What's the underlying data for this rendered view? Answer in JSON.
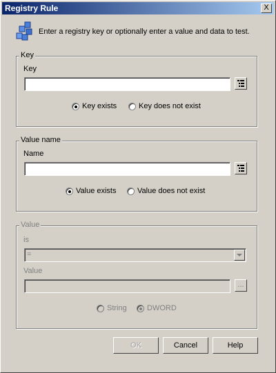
{
  "window": {
    "title": "Registry Rule",
    "close_label": "X"
  },
  "header": {
    "instruction": "Enter a registry key or optionally enter a value and data to test.",
    "icon": "registry-cubes-icon"
  },
  "key_group": {
    "legend": "Key",
    "field_label": "Key",
    "field_value": "",
    "radio_exists": "Key exists",
    "radio_not_exists": "Key does not exist",
    "selected": "exists"
  },
  "value_name_group": {
    "legend": "Value name",
    "field_label": "Name",
    "field_value": "",
    "radio_exists": "Value exists",
    "radio_not_exists": "Value does not exist",
    "selected": "exists"
  },
  "value_group": {
    "legend": "Value",
    "is_label": "is",
    "operator": "=",
    "value_label": "Value",
    "value_value": "",
    "browse_label": "...",
    "radio_string": "String",
    "radio_dword": "DWORD",
    "selected_type": "DWORD"
  },
  "buttons": {
    "ok": "OK",
    "cancel": "Cancel",
    "help": "Help"
  }
}
